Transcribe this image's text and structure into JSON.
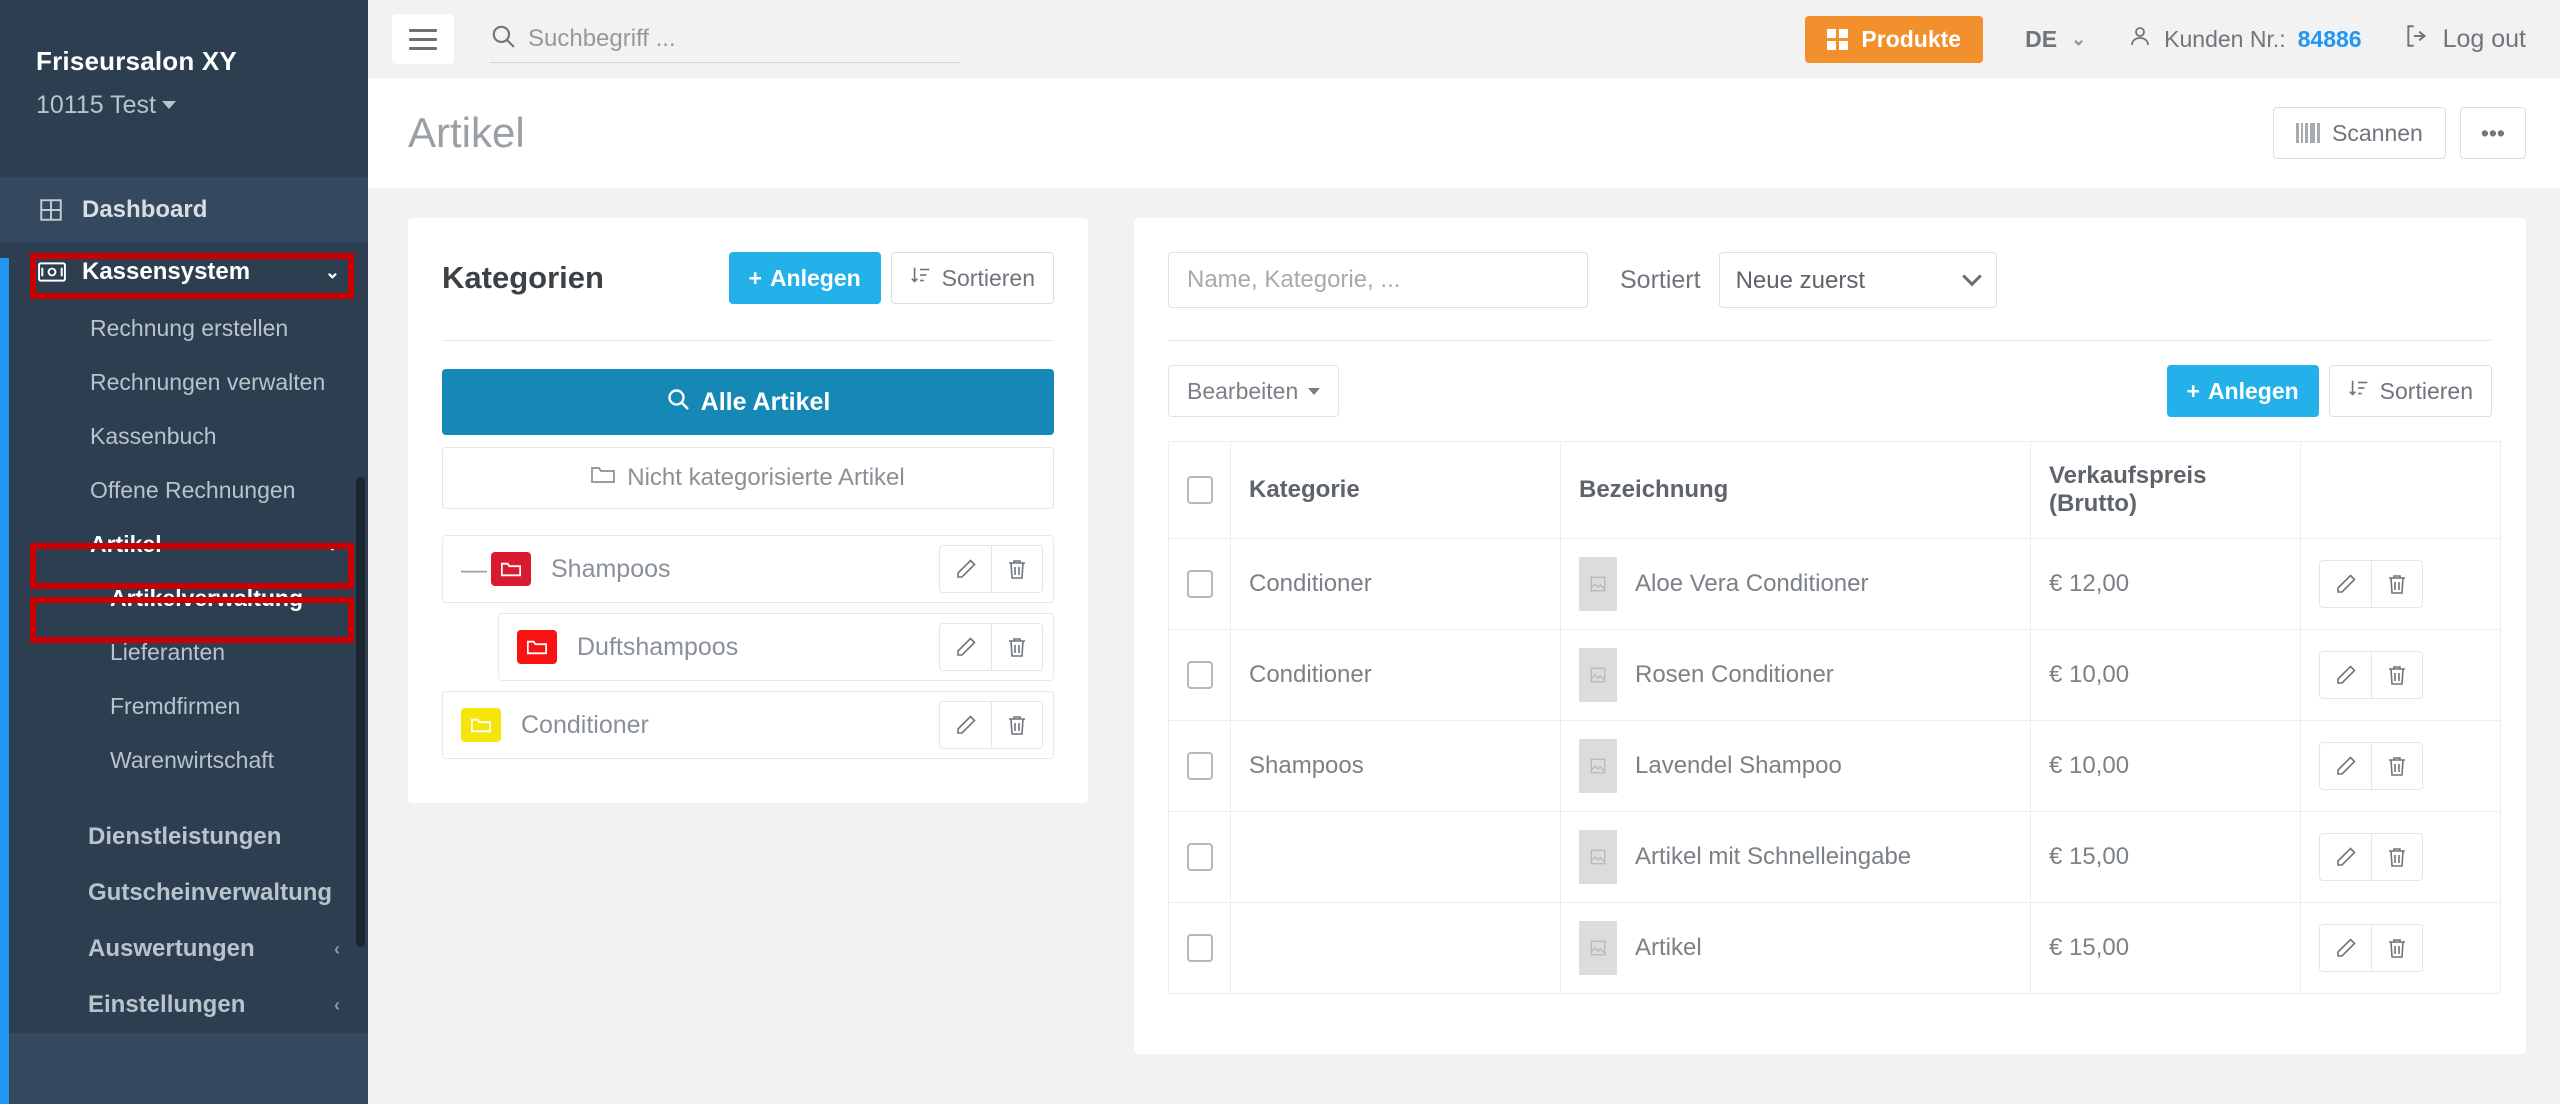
{
  "sidebar": {
    "brand": {
      "name": "Friseursalon XY",
      "location": "10115 Test"
    },
    "dashboard": "Dashboard",
    "items": [
      {
        "label": "Kassensystem",
        "icon": "cash-icon",
        "type": "parent",
        "chevron": "down"
      },
      {
        "label": "Rechnung erstellen",
        "type": "child"
      },
      {
        "label": "Rechnungen verwalten",
        "type": "child"
      },
      {
        "label": "Kassenbuch",
        "type": "child"
      },
      {
        "label": "Offene Rechnungen",
        "type": "child"
      },
      {
        "label": "Artikel",
        "type": "parent-sub",
        "chevron": "down"
      },
      {
        "label": "Artikelverwaltung",
        "type": "child-active"
      },
      {
        "label": "Lieferanten",
        "type": "child"
      },
      {
        "label": "Fremdfirmen",
        "type": "child"
      },
      {
        "label": "Warenwirtschaft",
        "type": "child"
      },
      {
        "label": "Dienstleistungen",
        "type": "section"
      },
      {
        "label": "Gutscheinverwaltung",
        "type": "section"
      },
      {
        "label": "Auswertungen",
        "type": "section",
        "chevron": "left"
      },
      {
        "label": "Einstellungen",
        "type": "section",
        "chevron": "left"
      }
    ]
  },
  "topbar": {
    "search_placeholder": "Suchbegriff ...",
    "produkte_label": "Produkte",
    "language": "DE",
    "kunden_label": "Kunden Nr.:",
    "kunden_nr": "84886",
    "logout_label": "Log out"
  },
  "pagehead": {
    "title": "Artikel",
    "scan_label": "Scannen",
    "more_label": "•••"
  },
  "kategorien": {
    "title": "Kategorien",
    "anlegen_label": "Anlegen",
    "sortieren_label": "Sortieren",
    "alle_artikel_label": "Alle Artikel",
    "nicht_kategorisiert_label": "Nicht kategorisierte Artikel",
    "tree": [
      {
        "name": "Shampoos",
        "color": "#d81b2f",
        "indent": false,
        "collapsible": true
      },
      {
        "name": "Duftshampoos",
        "color": "#f81313",
        "indent": true,
        "collapsible": false
      },
      {
        "name": "Conditioner",
        "color": "#f5e50a",
        "indent": false,
        "collapsible": false
      }
    ]
  },
  "artikel": {
    "filter_placeholder": "Name, Kategorie, ...",
    "sortiert_label": "Sortiert",
    "sort_value": "Neue zuerst",
    "sort_options": [
      "Neue zuerst"
    ],
    "bearbeiten_label": "Bearbeiten",
    "anlegen_label": "Anlegen",
    "sortieren_label": "Sortieren",
    "columns": [
      "",
      "Kategorie",
      "Bezeichnung",
      "Verkaufspreis (Brutto)",
      ""
    ],
    "column_preis_line1": "Verkaufspreis",
    "column_preis_line2": "(Brutto)",
    "rows": [
      {
        "kategorie": "Conditioner",
        "bezeichnung": "Aloe Vera Conditioner",
        "preis": "€ 12,00"
      },
      {
        "kategorie": "Conditioner",
        "bezeichnung": "Rosen Conditioner",
        "preis": "€ 10,00"
      },
      {
        "kategorie": "Shampoos",
        "bezeichnung": "Lavendel Shampoo",
        "preis": "€ 10,00"
      },
      {
        "kategorie": "",
        "bezeichnung": "Artikel mit Schnelleingabe",
        "preis": "€ 15,00"
      },
      {
        "kategorie": "",
        "bezeichnung": "Artikel",
        "preis": "€ 15,00"
      }
    ]
  },
  "colors": {
    "sidebar_bg": "#2c3e50",
    "accent_blue": "#2196f3",
    "primary_blue": "#24b0e8",
    "alle_artikel_blue": "#1688b5",
    "orange": "#f1902c",
    "annotation_red": "#cc0000"
  }
}
